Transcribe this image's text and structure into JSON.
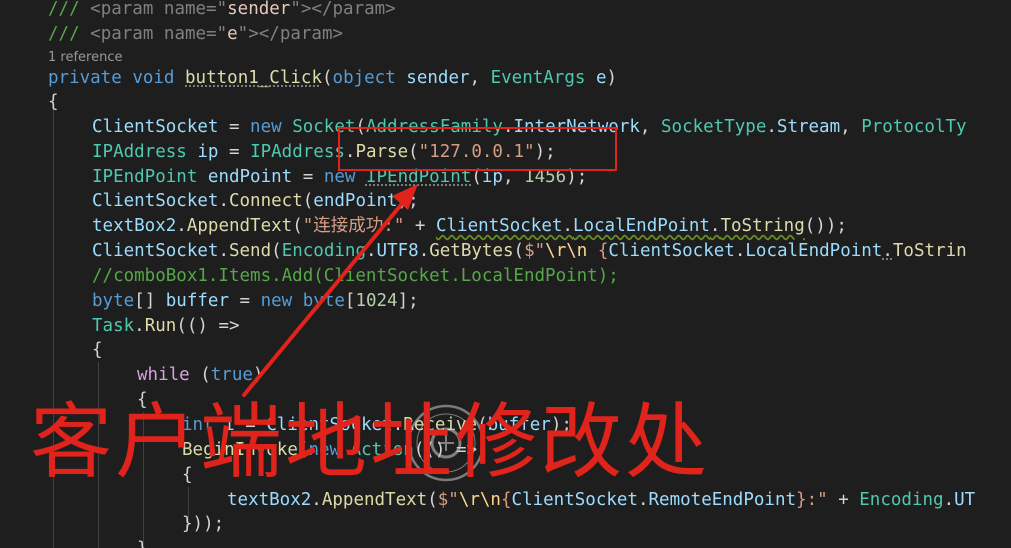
{
  "code": {
    "codelens": "1 reference",
    "lines": [
      [
        "/// ",
        "<param name=\"",
        "sender",
        "\">",
        "</param>"
      ],
      [
        "/// ",
        "<param name=\"",
        "e",
        "\">",
        "</param>"
      ],
      [
        "private",
        " ",
        "void",
        " ",
        "button1_Click",
        "(",
        "object",
        " ",
        "sender",
        ", ",
        "EventArgs",
        " ",
        "e",
        ")"
      ],
      [
        "{"
      ],
      [
        "ClientSocket",
        " = ",
        "new",
        " ",
        "Socket",
        "(",
        "AddressFamily",
        ".",
        "InterNetwork",
        ", ",
        "SocketType",
        ".",
        "Stream",
        ", ",
        "ProtocolTy"
      ],
      [
        "IPAddress",
        " ",
        "ip",
        " = ",
        "IPAddress",
        ".",
        "Parse",
        "(",
        "\"127.0.0.1\"",
        ");"
      ],
      [
        "IPEndPoint",
        " ",
        "endPoint",
        " = ",
        "new",
        " ",
        "IPEndPoint",
        "(",
        "ip",
        ", ",
        "1456",
        ");"
      ],
      [
        "ClientSocket",
        ".",
        "Connect",
        "(",
        "endPoint",
        ");"
      ],
      [
        "textBox2",
        ".",
        "AppendText",
        "(",
        "\"连接成功:\"",
        " + ",
        "ClientSocket",
        ".",
        "LocalEndPoint",
        ".",
        "ToString",
        "());"
      ],
      [
        "ClientSocket",
        ".",
        "Send",
        "(",
        "Encoding",
        ".",
        "UTF8",
        ".",
        "GetBytes",
        "(",
        "$\"",
        "\\r\\n",
        " {",
        "ClientSocket",
        ".",
        "LocalEndPoint",
        ".",
        "ToStrin"
      ],
      [
        "//comboBox1.Items.Add(ClientSocket.LocalEndPoint);"
      ],
      [
        "byte",
        "[] ",
        "buffer",
        " = ",
        "new",
        " ",
        "byte",
        "[",
        "1024",
        "];"
      ],
      [
        "Task",
        ".",
        "Run",
        "(() =>"
      ],
      [
        "{"
      ],
      [
        "while",
        " (",
        "true",
        ")"
      ],
      [
        "{"
      ],
      [
        "int",
        " ",
        "i",
        " = ",
        "ClientSocket",
        ".",
        "Receive",
        "(",
        "buffer",
        ");"
      ],
      [
        "BeginInvoke",
        "(",
        "new",
        " ",
        "Action",
        "(() =>"
      ],
      [
        "{"
      ],
      [
        "textBox2",
        ".",
        "AppendText",
        "(",
        "$\"",
        "\\r\\n",
        "{",
        "ClientSocket",
        ".",
        "RemoteEndPoint",
        "}",
        ":\"",
        " + ",
        "Encoding",
        ".",
        "UT"
      ],
      [
        "}));"
      ],
      [
        "}"
      ]
    ]
  },
  "annotation": {
    "text": "客户端地址修改处",
    "color": "#e0231b"
  },
  "theme": {
    "background": "#1e1e1e",
    "annotation_red": "#e0231b"
  },
  "icons": [
    "watermark-seal-icon"
  ]
}
